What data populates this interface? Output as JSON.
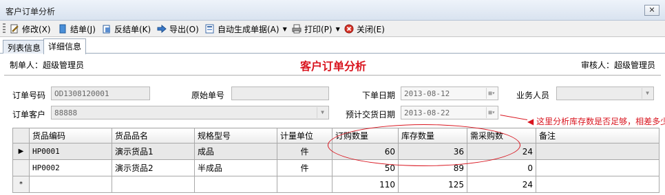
{
  "window": {
    "title": "客户订单分析",
    "close_label": "✕"
  },
  "toolbar": {
    "modify": "修改(X)",
    "finalize": "结单(J)",
    "unfinalize": "反结单(K)",
    "export": "导出(O)",
    "auto_generate": "自动生成单据(A)",
    "print": "打印(P)",
    "close": "关闭(E)"
  },
  "tabs": [
    "列表信息",
    "详细信息"
  ],
  "header": {
    "maker": "制单人：超级管理员",
    "title": "客户订单分析",
    "reviewer": "审核人：超级管理员"
  },
  "form": {
    "order_no_label": "订单号码",
    "order_no": "OD1308120001",
    "orig_no_label": "原始单号",
    "orig_no": "",
    "order_date_label": "下单日期",
    "order_date": "2013-08-12",
    "salesperson_label": "业务人员",
    "salesperson": "",
    "customer_label": "订单客户",
    "customer": "88888",
    "delivery_label": "预计交货日期",
    "delivery_date": "2013-08-22"
  },
  "annotation": "这里分析库存数是否足够，相差多少",
  "grid": {
    "columns": [
      "货品编码",
      "货品品名",
      "规格型号",
      "计量单位",
      "订购数量",
      "库存数量",
      "需采购数",
      "备注"
    ],
    "rows": [
      {
        "marker": "▶",
        "code": "HP0001",
        "name": "演示货品1",
        "spec": "成品",
        "unit": "件",
        "ordered": "60",
        "stock": "36",
        "need": "24",
        "note": ""
      },
      {
        "marker": "",
        "code": "HP0002",
        "name": "演示货品2",
        "spec": "半成品",
        "unit": "件",
        "ordered": "50",
        "stock": "89",
        "need": "0",
        "note": ""
      }
    ],
    "totals": {
      "marker": "*",
      "ordered": "110",
      "stock": "125",
      "need": "24"
    }
  },
  "colors": {
    "accent": "#d9141e",
    "header_bg": "#d9e3f0"
  }
}
